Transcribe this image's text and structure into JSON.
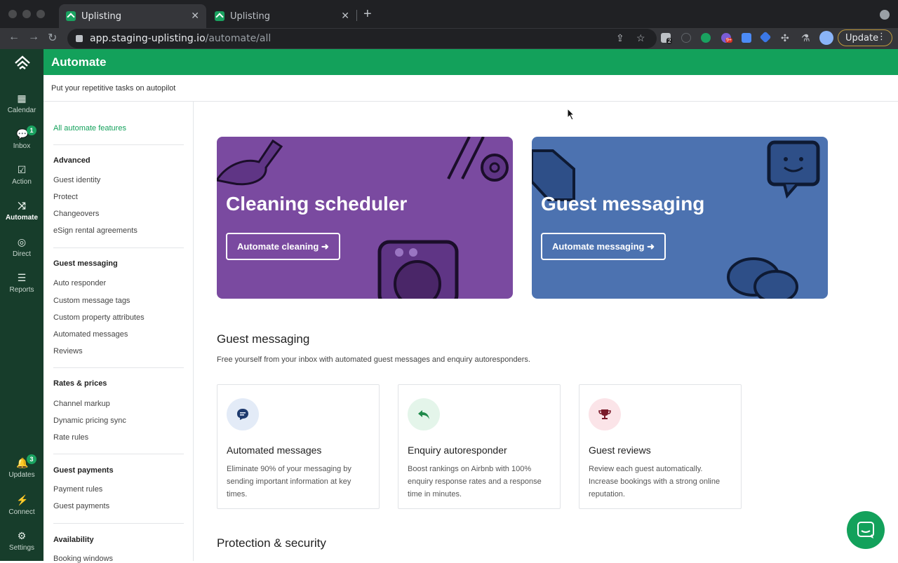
{
  "browser": {
    "tabs": [
      {
        "label": "Uplisting",
        "close": "✕"
      },
      {
        "label": "Uplisting",
        "close": "✕"
      }
    ],
    "new_tab": "+",
    "url_host": "app.staging-uplisting.io",
    "url_path": "/automate/all",
    "update_label": "Update",
    "ext_badge_count": "2",
    "ext_badge_more": "9+"
  },
  "nav": {
    "items": [
      {
        "label": "Calendar",
        "icon": "calendar-icon"
      },
      {
        "label": "Inbox",
        "icon": "chat-icon",
        "badge": "1"
      },
      {
        "label": "Action",
        "icon": "check-icon"
      },
      {
        "label": "Automate",
        "icon": "shuffle-icon"
      },
      {
        "label": "Direct",
        "icon": "direct-icon"
      },
      {
        "label": "Reports",
        "icon": "database-icon"
      },
      {
        "label": "Updates",
        "icon": "bell-icon",
        "badge": "3"
      },
      {
        "label": "Connect",
        "icon": "plug-icon"
      },
      {
        "label": "Settings",
        "icon": "gear-icon"
      }
    ]
  },
  "header": {
    "title": "Automate",
    "subtitle": "Put your repetitive tasks on autopilot"
  },
  "sidebar": {
    "all_link": "All automate features",
    "groups": [
      {
        "title": "Advanced",
        "items": [
          "Guest identity",
          "Protect",
          "Changeovers",
          "eSign rental agreements"
        ]
      },
      {
        "title": "Guest messaging",
        "items": [
          "Auto responder",
          "Custom message tags",
          "Custom property attributes",
          "Automated messages",
          "Reviews"
        ]
      },
      {
        "title": "Rates & prices",
        "items": [
          "Channel markup",
          "Dynamic pricing sync",
          "Rate rules"
        ]
      },
      {
        "title": "Guest payments",
        "items": [
          "Payment rules",
          "Guest payments"
        ]
      },
      {
        "title": "Availability",
        "items": [
          "Booking windows"
        ]
      }
    ]
  },
  "hero": [
    {
      "title": "Cleaning scheduler",
      "button": "Automate cleaning ➜",
      "color": "#7a4aa0"
    },
    {
      "title": "Guest messaging",
      "button": "Automate messaging ➜",
      "color": "#4c72b0"
    }
  ],
  "sections": [
    {
      "title": "Guest messaging",
      "subtitle": "Free yourself from your inbox with automated guest messages and enquiry autoresponders.",
      "cards": [
        {
          "title": "Automated messages",
          "desc": "Eliminate 90% of your messaging by sending important information at key times.",
          "icon": "message-icon",
          "icon_bg": "#e3ebf7",
          "icon_color": "#1e3a6e"
        },
        {
          "title": "Enquiry autoresponder",
          "desc": "Boost rankings on Airbnb with 100% enquiry response rates and a response time in minutes.",
          "icon": "reply-icon",
          "icon_bg": "#e4f5ea",
          "icon_color": "#1f8a4a"
        },
        {
          "title": "Guest reviews",
          "desc": "Review each guest automatically. Increase bookings with a strong online reputation.",
          "icon": "trophy-icon",
          "icon_bg": "#fbe4e8",
          "icon_color": "#7a1a2a"
        }
      ]
    },
    {
      "title": "Protection & security"
    }
  ],
  "colors": {
    "brand": "#13a15b",
    "nav_bg": "#173d2b"
  }
}
